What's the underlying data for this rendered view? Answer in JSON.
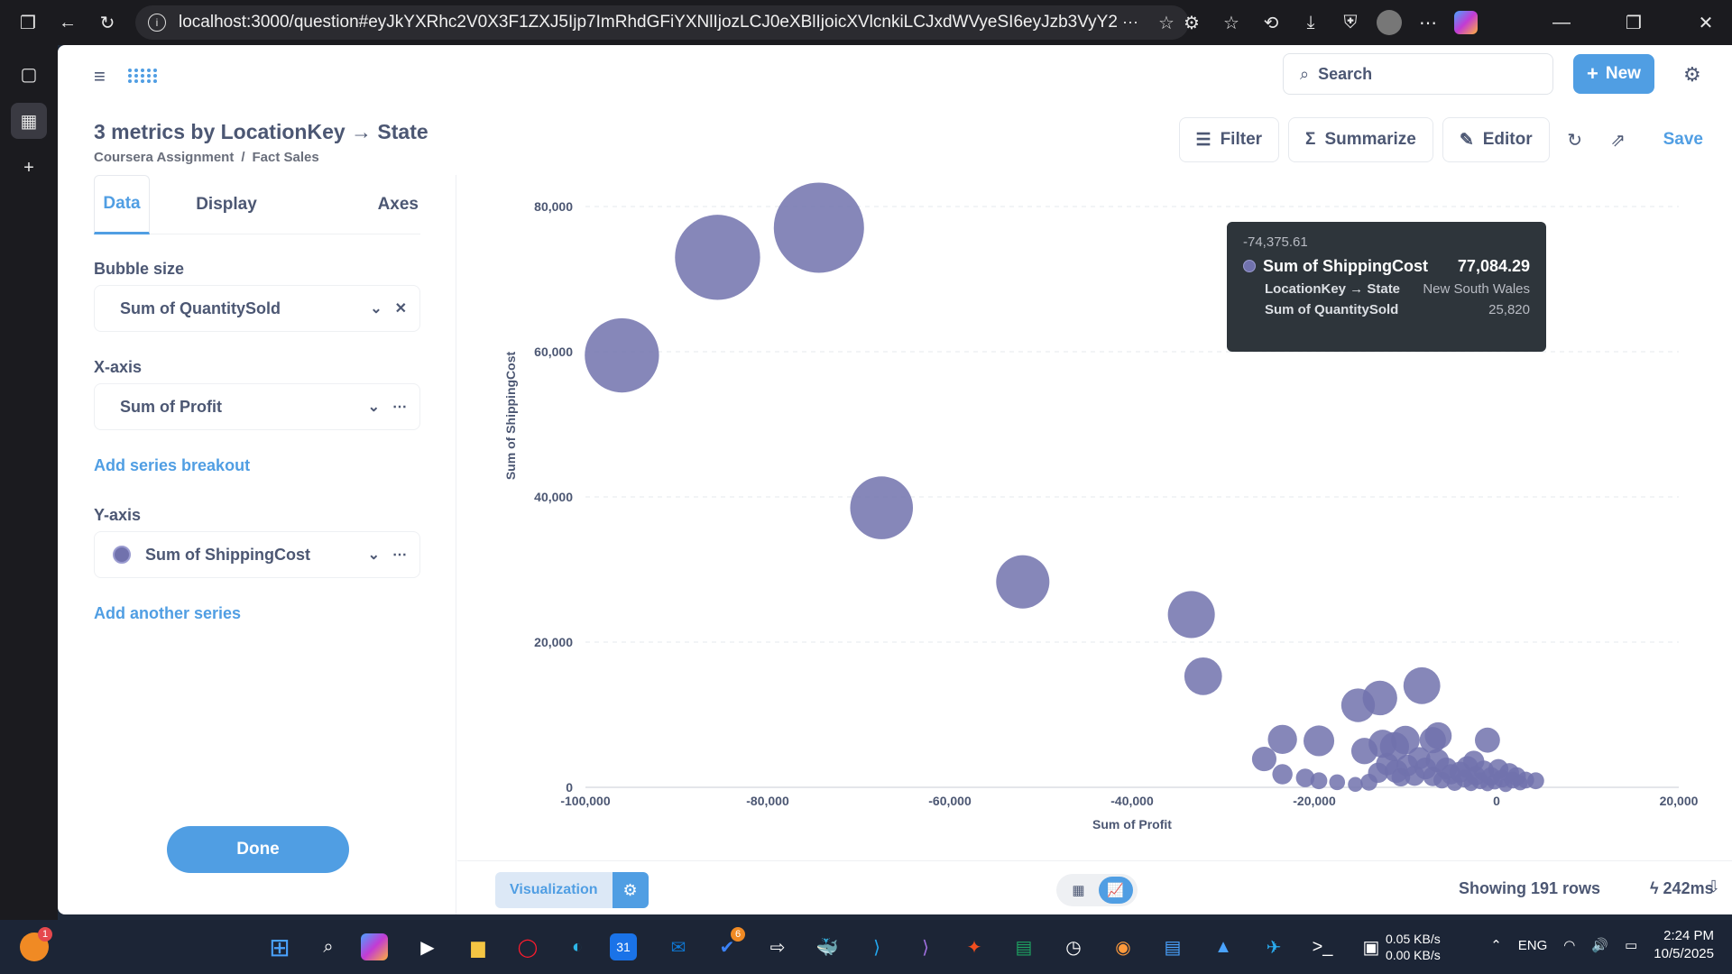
{
  "browser": {
    "url": "localhost:3000/question#eyJkYXRhc2V0X3F1ZXJ5Ijp7ImRhdGFiYXNlIjozLCJ0eXBlIjoicXVlcnkiLCJxdWVyeSI6eyJzb3VyY2UtdGFibGUiOj..."
  },
  "header": {
    "search_placeholder": "Search",
    "new_label": "New"
  },
  "question": {
    "title": "3 metrics by LocationKey → State",
    "breadcrumb": [
      "Coursera Assignment",
      "/",
      "Fact Sales"
    ]
  },
  "actions": {
    "filter": "Filter",
    "summarize": "Summarize",
    "editor": "Editor",
    "save": "Save"
  },
  "sidebar": {
    "tabs": [
      "Data",
      "Display",
      "Axes"
    ],
    "bubble_size_label": "Bubble size",
    "bubble_size_value": "Sum of QuantitySold",
    "x_axis_label": "X-axis",
    "x_axis_value": "Sum of Profit",
    "add_breakout": "Add series breakout",
    "y_axis_label": "Y-axis",
    "y_axis_value": "Sum of ShippingCost",
    "add_series": "Add another series",
    "done": "Done"
  },
  "tooltip": {
    "header": "-74,375.61",
    "main_label": "Sum of ShippingCost",
    "main_value": "77,084.29",
    "row1_label": "LocationKey → State",
    "row1_value": "New South Wales",
    "row2_label": "Sum of QuantitySold",
    "row2_value": "25,820"
  },
  "footer": {
    "visualization": "Visualization",
    "rows": "Showing 191 rows",
    "time": "242ms"
  },
  "taskbar": {
    "lang": "ENG",
    "net_up": "0.05 KB/s",
    "net_down": "0.00 KB/s",
    "time": "2:24 PM",
    "date": "10/5/2025",
    "badge_left": "1",
    "badge_todo": "6"
  },
  "chart_data": {
    "type": "scatter",
    "xlabel": "Sum of Profit",
    "ylabel": "Sum of ShippingCost",
    "xlim": [
      -100000,
      20000
    ],
    "ylim": [
      0,
      80000
    ],
    "x_ticks": [
      "-100,000",
      "-80,000",
      "-60,000",
      "-40,000",
      "-20,000",
      "0",
      "20,000"
    ],
    "y_ticks": [
      "0",
      "20,000",
      "40,000",
      "60,000",
      "80,000"
    ],
    "color": "#7172ad",
    "points": [
      {
        "x": -74376,
        "y": 77084,
        "size": 25820
      },
      {
        "x": -85500,
        "y": 73000,
        "size": 23000
      },
      {
        "x": -96000,
        "y": 59500,
        "size": 17500
      },
      {
        "x": -67500,
        "y": 38500,
        "size": 12500
      },
      {
        "x": -52000,
        "y": 28300,
        "size": 9000
      },
      {
        "x": -33500,
        "y": 23800,
        "size": 7000
      },
      {
        "x": -32200,
        "y": 15300,
        "size": 4500
      },
      {
        "x": -8200,
        "y": 14000,
        "size": 4300
      },
      {
        "x": -12800,
        "y": 12300,
        "size": 3800
      },
      {
        "x": -15200,
        "y": 11300,
        "size": 3600
      },
      {
        "x": -23500,
        "y": 6600,
        "size": 2700
      },
      {
        "x": -19500,
        "y": 6400,
        "size": 3000
      },
      {
        "x": -25500,
        "y": 3900,
        "size": 1900
      },
      {
        "x": -23500,
        "y": 1800,
        "size": 1300
      },
      {
        "x": -21000,
        "y": 1300,
        "size": 1100
      },
      {
        "x": -19500,
        "y": 900,
        "size": 900
      },
      {
        "x": -17500,
        "y": 700,
        "size": 800
      },
      {
        "x": -14500,
        "y": 5000,
        "size": 2200
      },
      {
        "x": -12500,
        "y": 6000,
        "size": 2500
      },
      {
        "x": -11200,
        "y": 5600,
        "size": 2700
      },
      {
        "x": -10000,
        "y": 6500,
        "size": 2600
      },
      {
        "x": -6400,
        "y": 7100,
        "size": 2300
      },
      {
        "x": -7000,
        "y": 6500,
        "size": 2200
      },
      {
        "x": -1000,
        "y": 6500,
        "size": 2000
      },
      {
        "x": -14000,
        "y": 700,
        "size": 900
      },
      {
        "x": -13000,
        "y": 2000,
        "size": 1300
      },
      {
        "x": -12000,
        "y": 3200,
        "size": 1600
      },
      {
        "x": -11000,
        "y": 2200,
        "size": 1700
      },
      {
        "x": -10500,
        "y": 1400,
        "size": 1100
      },
      {
        "x": -9800,
        "y": 3000,
        "size": 1500
      },
      {
        "x": -9000,
        "y": 1600,
        "size": 1300
      },
      {
        "x": -8500,
        "y": 4000,
        "size": 1600
      },
      {
        "x": -7800,
        "y": 2600,
        "size": 1500
      },
      {
        "x": -7000,
        "y": 1500,
        "size": 1200
      },
      {
        "x": -6500,
        "y": 3700,
        "size": 1700
      },
      {
        "x": -6000,
        "y": 1000,
        "size": 900
      },
      {
        "x": -5500,
        "y": 2600,
        "size": 1500
      },
      {
        "x": -5000,
        "y": 1800,
        "size": 1300
      },
      {
        "x": -4600,
        "y": 600,
        "size": 800
      },
      {
        "x": -4000,
        "y": 2100,
        "size": 1400
      },
      {
        "x": -3500,
        "y": 1200,
        "size": 1000
      },
      {
        "x": -3200,
        "y": 2800,
        "size": 1500
      },
      {
        "x": -2800,
        "y": 500,
        "size": 700
      },
      {
        "x": -2300,
        "y": 1600,
        "size": 1200
      },
      {
        "x": -1800,
        "y": 900,
        "size": 900
      },
      {
        "x": -1400,
        "y": 2300,
        "size": 1300
      },
      {
        "x": -1000,
        "y": 400,
        "size": 600
      },
      {
        "x": -600,
        "y": 1500,
        "size": 1100
      },
      {
        "x": -200,
        "y": 800,
        "size": 800
      },
      {
        "x": 200,
        "y": 2500,
        "size": 1300
      },
      {
        "x": 600,
        "y": 1200,
        "size": 1000
      },
      {
        "x": 1000,
        "y": 300,
        "size": 600
      },
      {
        "x": 1400,
        "y": 2000,
        "size": 1200
      },
      {
        "x": 1800,
        "y": 1000,
        "size": 900
      },
      {
        "x": 2200,
        "y": 1500,
        "size": 1100
      },
      {
        "x": 2600,
        "y": 600,
        "size": 700
      },
      {
        "x": 3200,
        "y": 1000,
        "size": 900
      },
      {
        "x": 4300,
        "y": 900,
        "size": 900
      },
      {
        "x": -15500,
        "y": 400,
        "size": 700
      },
      {
        "x": -2500,
        "y": 3600,
        "size": 1400
      }
    ]
  }
}
